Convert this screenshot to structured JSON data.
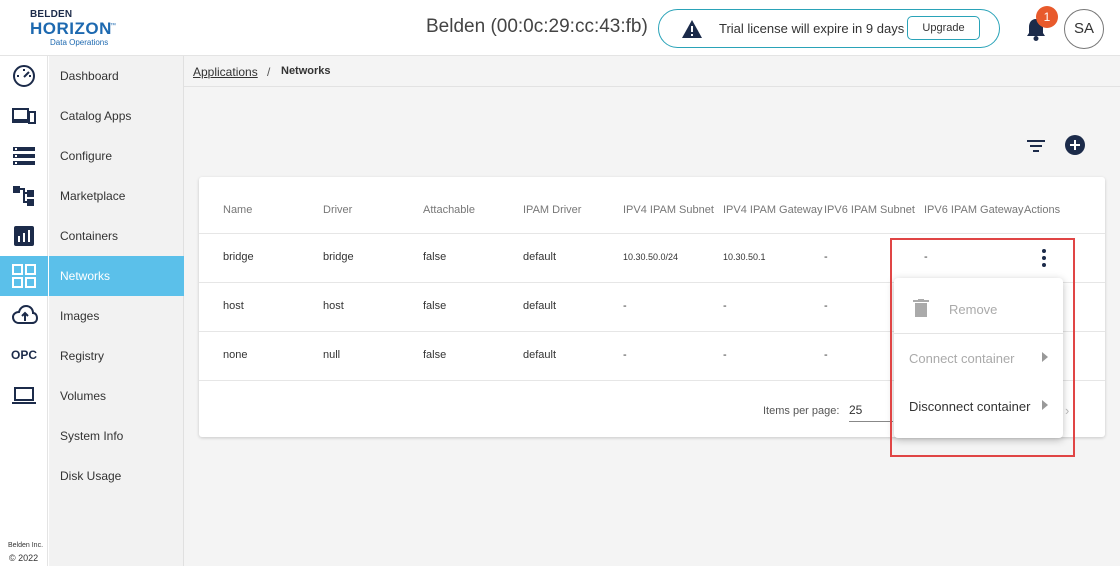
{
  "brand": {
    "line1": "BELDEN",
    "line2": "HORIZON",
    "line3": "Data Operations",
    "trademark": "™"
  },
  "header": {
    "device_title": "Belden (00:0c:29:cc:43:fb)",
    "license_message": "Trial license will expire in 9 days",
    "upgrade_label": "Upgrade",
    "notification_count": "1",
    "avatar_initials": "SA"
  },
  "rail": {
    "icons": [
      "speedometer-icon",
      "devices-icon",
      "list-icon",
      "hierarchy-icon",
      "bar-chart-icon",
      "grid-icon",
      "cloud-upload-icon",
      "opc-icon",
      "laptop-icon"
    ],
    "opc_text": "OPC",
    "copyright_line1": "Belden Inc.",
    "copyright_line2": "© 2022"
  },
  "sidebar": {
    "items": [
      {
        "label": "Dashboard"
      },
      {
        "label": "Catalog Apps"
      },
      {
        "label": "Configure"
      },
      {
        "label": "Marketplace"
      },
      {
        "label": "Containers"
      },
      {
        "label": "Networks"
      },
      {
        "label": "Images"
      },
      {
        "label": "Registry"
      },
      {
        "label": "Volumes"
      },
      {
        "label": "System Info"
      },
      {
        "label": "Disk Usage"
      }
    ],
    "active": "Networks"
  },
  "breadcrumb": {
    "parent": "Applications",
    "separator": "/",
    "current": "Networks"
  },
  "table": {
    "columns": [
      "Name",
      "Driver",
      "Attachable",
      "IPAM Driver",
      "IPV4 IPAM Subnet",
      "IPV4 IPAM Gateway",
      "IPV6 IPAM Subnet",
      "IPV6 IPAM Gateway",
      "Actions"
    ],
    "rows": [
      {
        "name": "bridge",
        "driver": "bridge",
        "attachable": "false",
        "ipam_driver": "default",
        "ipv4_subnet": "10.30.50.0/24",
        "ipv4_gateway": "10.30.50.1",
        "ipv6_subnet": "-",
        "ipv6_gateway": "-"
      },
      {
        "name": "host",
        "driver": "host",
        "attachable": "false",
        "ipam_driver": "default",
        "ipv4_subnet": "-",
        "ipv4_gateway": "-",
        "ipv6_subnet": "-",
        "ipv6_gateway": ""
      },
      {
        "name": "none",
        "driver": "null",
        "attachable": "false",
        "ipam_driver": "default",
        "ipv4_subnet": "-",
        "ipv4_gateway": "-",
        "ipv6_subnet": "-",
        "ipv6_gateway": ""
      }
    ],
    "items_per_page_label": "Items per page:",
    "items_per_page_value": "25"
  },
  "actions_menu": {
    "items": [
      {
        "label": "Remove",
        "icon": "trash-icon",
        "disabled": true
      },
      {
        "label": "Connect container",
        "disabled": true,
        "submenu": true
      },
      {
        "label": "Disconnect container",
        "disabled": false,
        "submenu": true
      }
    ]
  },
  "colors": {
    "accent": "#5bc0ea",
    "brand_blue": "#1d69b0",
    "license_border": "#2aa3b8",
    "badge": "#e85a2c",
    "highlight": "#e04545"
  }
}
